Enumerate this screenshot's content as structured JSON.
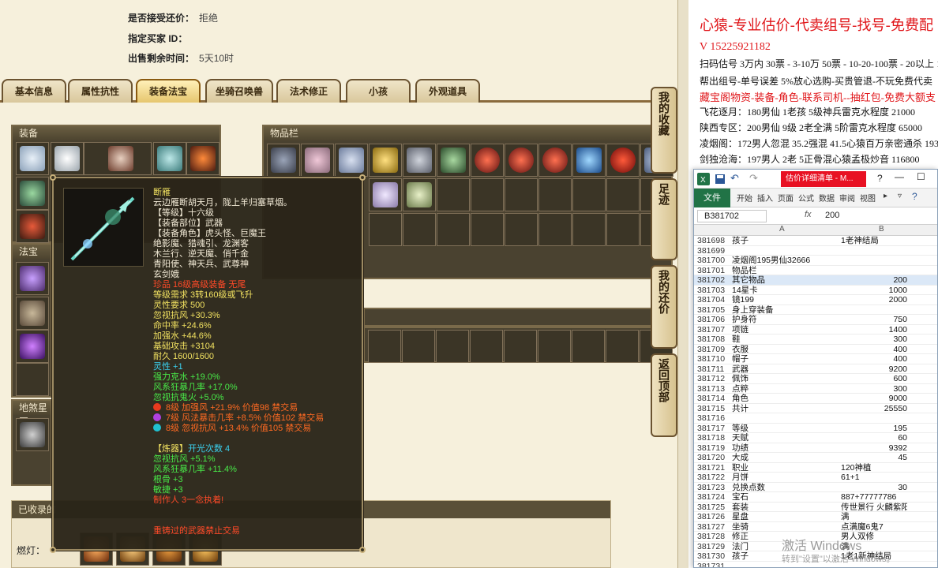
{
  "info": {
    "accept_counter_label": "是否接受还价：",
    "accept_counter_value": "拒绝",
    "buyer_label": "指定买家 ID：",
    "buyer_value": "",
    "remaining_label": "出售剩余时间：",
    "remaining_value": "5天10时"
  },
  "tabs": [
    "基本信息",
    "属性抗性",
    "装备法宝",
    "坐骑召唤兽",
    "法术修正",
    "小孩",
    "外观道具"
  ],
  "active_tab": "装备法宝",
  "panels": {
    "equipment_title": "装备",
    "inventory_title": "物品栏",
    "fabao_title": "法宝",
    "earth_title": "地煞星图",
    "collected_title": "已收录的",
    "lamp_label": "燃灯："
  },
  "side_buttons": [
    "我的收藏",
    "足迹",
    "我的还价",
    "返回顶部"
  ],
  "tooltip": {
    "lines": [
      {
        "text": "断雁",
        "color": "yellow"
      },
      {
        "text": "云边雁断胡天月，陇上羊归塞草烟。",
        "color": "white"
      },
      {
        "text": "【等级】十六级",
        "color": "white"
      },
      {
        "text": "【装备部位】武器",
        "color": "white"
      },
      {
        "text": "【装备角色】虎头怪、巨魔王",
        "color": "white"
      },
      {
        "text": "绝影魔、猎魂引、龙渊客",
        "color": "white"
      },
      {
        "text": "木兰行、逆天魔、俏千金",
        "color": "white"
      },
      {
        "text": "青阳使、神天兵、武尊神",
        "color": "white"
      },
      {
        "text": "玄剑娥",
        "color": "white"
      },
      {
        "text": "珍品 16级高级装备 无尾",
        "color": "red"
      },
      {
        "text": "等级需求 3转160级或飞升",
        "color": "yellow"
      },
      {
        "text": "灵性要求 500",
        "color": "yellow"
      },
      {
        "text": "忽视抗风 +30.3%",
        "color": "yellow"
      },
      {
        "text": "命中率 +24.6%",
        "color": "yellow"
      },
      {
        "text": "加强水 +44.6%",
        "color": "yellow"
      },
      {
        "text": "基础攻击 +3104",
        "color": "yellow"
      },
      {
        "text": "耐久 1600/1600",
        "color": "yellow"
      },
      {
        "text": "灵性 +1",
        "color": "cyan"
      },
      {
        "text": "强力克水 +19.0%",
        "color": "green"
      },
      {
        "text": "风系狂暴几率 +17.0%",
        "color": "green"
      },
      {
        "text": "忽视抗鬼火 +5.0%",
        "color": "green"
      }
    ],
    "gems": [
      {
        "text": "8级 加强风 +21.9% 价值98 禁交易",
        "color": "#e83a1e"
      },
      {
        "text": "7级 风法暴击几率 +8.5% 价值102 禁交易",
        "color": "#b040e0"
      },
      {
        "text": "8级 忽视抗风 +13.4% 价值105 禁交易",
        "color": "#20c0d0"
      }
    ],
    "refine_title": "【炼器】",
    "refine_count": "开光次数 4",
    "refine_lines": [
      "忽视抗风 +5.1%",
      "风系狂暴几率 +11.4%",
      "根骨 +3",
      "敏捷 +3"
    ],
    "maker": "制作人 3一念执着!",
    "footer": "重铸过的武器禁止交易"
  },
  "right": {
    "headline": "心猿-专业估价-代卖组号-找号-免费配",
    "phone": "V 15225921182",
    "line1": "扫码估号 3万内 30票 - 3-10万 50票 - 10-20-100票 - 20以上 15",
    "line2": "帮出组号-单号误差 5%放心选购-买贵管退-不玩免费代卖",
    "line3": "藏宝阁物资-装备-角色-联系司机--抽红包-免费大额支",
    "line4": "飞花逐月：180男仙 1老孩 5级神兵雷克水程度 21000",
    "line5": "陕西专区：200男仙 9级 2老全满 5阶雷克水程度 65000",
    "line6": "凌烟阁：172男人忽混 35.2强混 41.5心猿百万亲密通杀 193",
    "line7": "剑独沧海：197男人 2老 5正骨混心猿孟极炒音 116800"
  },
  "excel": {
    "doc_title": "估价详细清单 - M...",
    "ribbon": [
      "文件",
      "开始",
      "插入",
      "页面",
      "公式",
      "数据",
      "审阅",
      "视图"
    ],
    "name_box": "B381702",
    "fx": "fx",
    "formula_value": "200",
    "col_a": "A",
    "col_b": "B",
    "rows": [
      {
        "n": "381698",
        "a": "孩子",
        "b": "1老神结局",
        "left": true
      },
      {
        "n": "381699",
        "a": "",
        "b": ""
      },
      {
        "n": "381700",
        "a": "凌烟阁195男仙32666",
        "b": ""
      },
      {
        "n": "381701",
        "a": "物品栏",
        "b": ""
      },
      {
        "n": "381702",
        "a": "其它物品",
        "b": "200",
        "sel": true
      },
      {
        "n": "381703",
        "a": "14星卡",
        "b": "1000"
      },
      {
        "n": "381704",
        "a": "镜199",
        "b": "2000"
      },
      {
        "n": "381705",
        "a": "身上穿装备",
        "b": ""
      },
      {
        "n": "381706",
        "a": "护身符",
        "b": "750"
      },
      {
        "n": "381707",
        "a": "项链",
        "b": "1400"
      },
      {
        "n": "381708",
        "a": "鞋",
        "b": "300"
      },
      {
        "n": "381709",
        "a": "衣服",
        "b": "400"
      },
      {
        "n": "381710",
        "a": "帽子",
        "b": "400"
      },
      {
        "n": "381711",
        "a": "武器",
        "b": "9200"
      },
      {
        "n": "381712",
        "a": "佩饰",
        "b": "600"
      },
      {
        "n": "381713",
        "a": "点粹",
        "b": "300"
      },
      {
        "n": "381714",
        "a": "角色",
        "b": "9000"
      },
      {
        "n": "381715",
        "a": "共计",
        "b": "25550"
      },
      {
        "n": "381716",
        "a": "",
        "b": ""
      },
      {
        "n": "381717",
        "a": "等级",
        "b": "195"
      },
      {
        "n": "381718",
        "a": "天赋",
        "b": "60"
      },
      {
        "n": "381719",
        "a": "功绩",
        "b": "9392"
      },
      {
        "n": "381720",
        "a": "大成",
        "b": "45"
      },
      {
        "n": "381721",
        "a": "职业",
        "b": "120神植",
        "left": true
      },
      {
        "n": "381722",
        "a": "月饼",
        "b": "61+1",
        "left": true
      },
      {
        "n": "381723",
        "a": "兑换点数",
        "b": "30"
      },
      {
        "n": "381724",
        "a": "宝石",
        "b": "887+77777786",
        "left": true
      },
      {
        "n": "381725",
        "a": "套装",
        "b": "传世景行 火麟紫阳",
        "left": true
      },
      {
        "n": "381726",
        "a": "星盘",
        "b": "满",
        "left": true
      },
      {
        "n": "381727",
        "a": "坐骑",
        "b": "点满魔6鬼7",
        "left": true
      },
      {
        "n": "381728",
        "a": "修正",
        "b": "男人双修",
        "left": true
      },
      {
        "n": "381729",
        "a": "法门",
        "b": "满",
        "left": true
      },
      {
        "n": "381730",
        "a": "孩子",
        "b": "1老1新神结局",
        "left": true
      },
      {
        "n": "381731",
        "a": "",
        "b": ""
      }
    ]
  },
  "watermark": {
    "line1": "激活 Windows",
    "line2": "转到\"设置\"以激活 Windows。"
  },
  "colors": {
    "accent_red": "#e0161a",
    "excel_green": "#217346",
    "tooltip_bg": "#2a2418"
  }
}
